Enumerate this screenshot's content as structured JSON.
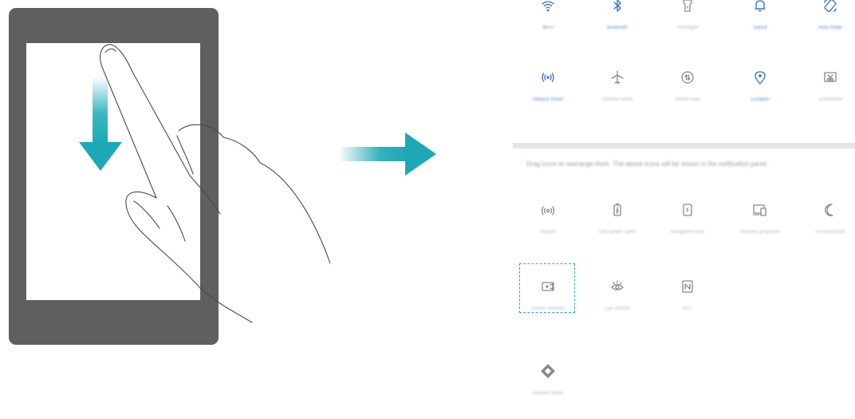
{
  "colors": {
    "tablet_body": "#5f5f61",
    "teal_arrow": "#1ca9b5",
    "active_icon": "#2f6fd1",
    "inactive_icon": "#8a8a8a",
    "dashed_highlight": "#1cb3c1"
  },
  "top_tiles": [
    {
      "icon": "wifi-icon",
      "label": "Wi-Fi",
      "active": true
    },
    {
      "icon": "bluetooth-icon",
      "label": "Bluetooth",
      "active": true
    },
    {
      "icon": "flashlight-icon",
      "label": "Flashlight",
      "active": false
    },
    {
      "icon": "bell-icon",
      "label": "Sound",
      "active": true
    },
    {
      "icon": "auto-rotate-icon",
      "label": "Auto-rotate",
      "active": true
    }
  ],
  "second_tiles": [
    {
      "icon": "hotspot-icon",
      "label": "Hotspot Share",
      "active": true
    },
    {
      "icon": "airplane-icon",
      "label": "Airplane mode",
      "active": false
    },
    {
      "icon": "mobile-data-icon",
      "label": "Mobile data",
      "active": false
    },
    {
      "icon": "location-icon",
      "label": "Location",
      "active": true
    },
    {
      "icon": "screenshot-icon",
      "label": "Screenshot",
      "active": false
    }
  ],
  "hint_text": "Drag icons to rearrange them. The above icons will be shown in the notification panel.",
  "extra_tiles_row1": [
    {
      "icon": "wireless-icon",
      "label": "Hotspot"
    },
    {
      "icon": "battery-icon",
      "label": "Ultra power saver"
    },
    {
      "icon": "navigation-dock-icon",
      "label": "Navigation dock"
    },
    {
      "icon": "wireless-projection-icon",
      "label": "Wireless projection"
    },
    {
      "icon": "moon-icon",
      "label": "Do not disturb"
    }
  ],
  "extra_tiles_row2": [
    {
      "icon": "screen-recorder-icon",
      "label": "Screen recorder"
    },
    {
      "icon": "eye-comfort-icon",
      "label": "Eye comfort"
    },
    {
      "icon": "nfc-icon",
      "label": "NFC"
    }
  ],
  "extra_tiles_row3": [
    {
      "icon": "diamond-icon",
      "label": "Huawei Share"
    }
  ]
}
